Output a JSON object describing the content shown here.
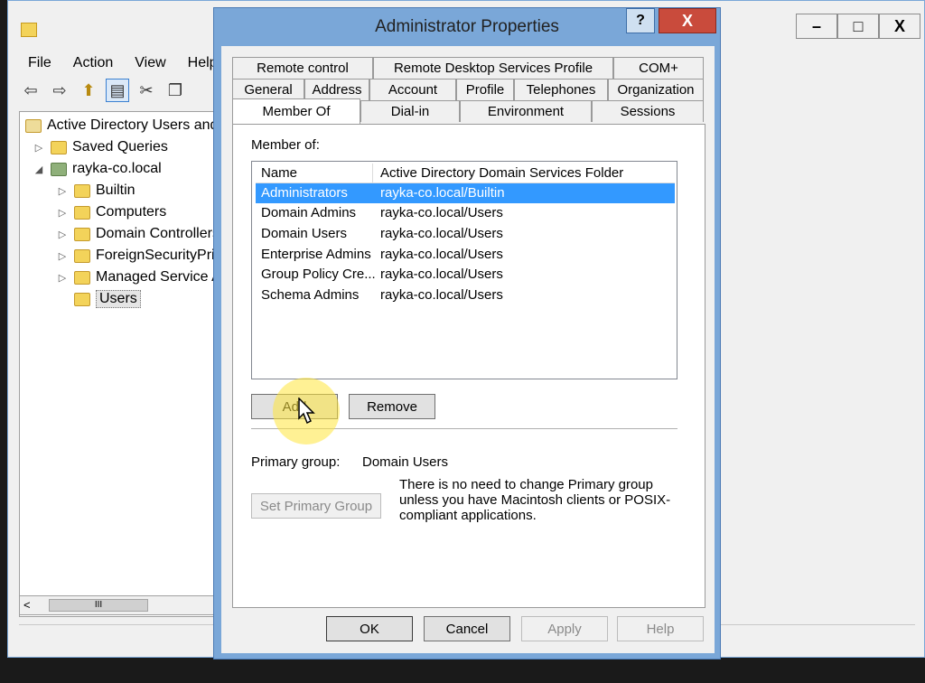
{
  "mmc": {
    "menu": [
      "File",
      "Action",
      "View",
      "Help"
    ],
    "window_buttons": [
      "–",
      "□",
      "X"
    ],
    "tree": [
      {
        "label": "Active Directory Users and",
        "level": 0,
        "expander": ""
      },
      {
        "label": "Saved Queries",
        "level": 1,
        "expander": "▷"
      },
      {
        "label": "rayka-co.local",
        "level": 1,
        "expander": "◢"
      },
      {
        "label": "Builtin",
        "level": 2,
        "expander": "▷"
      },
      {
        "label": "Computers",
        "level": 2,
        "expander": "▷"
      },
      {
        "label": "Domain Controllers",
        "level": 2,
        "expander": "▷"
      },
      {
        "label": "ForeignSecurityPrin",
        "level": 2,
        "expander": "▷"
      },
      {
        "label": "Managed Service A",
        "level": 2,
        "expander": "▷"
      },
      {
        "label": "Users",
        "level": 2,
        "expander": ""
      }
    ],
    "scroll_left": "<",
    "scroll_thumb": "III"
  },
  "dialog": {
    "title": "Administrator Properties",
    "help": "?",
    "close": "X",
    "tabs_row1": [
      "Remote control",
      "Remote Desktop Services Profile",
      "COM+"
    ],
    "tabs_row2": [
      "General",
      "Address",
      "Account",
      "Profile",
      "Telephones",
      "Organization"
    ],
    "tabs_row3": [
      "Member Of",
      "Dial-in",
      "Environment",
      "Sessions"
    ],
    "member_of_label": "Member of:",
    "columns": [
      "Name",
      "Active Directory Domain Services Folder"
    ],
    "rows": [
      {
        "name": "Administrators",
        "folder": "rayka-co.local/Builtin"
      },
      {
        "name": "Domain Admins",
        "folder": "rayka-co.local/Users"
      },
      {
        "name": "Domain Users",
        "folder": "rayka-co.local/Users"
      },
      {
        "name": "Enterprise Admins",
        "folder": "rayka-co.local/Users"
      },
      {
        "name": "Group Policy Cre...",
        "folder": "rayka-co.local/Users"
      },
      {
        "name": "Schema Admins",
        "folder": "rayka-co.local/Users"
      }
    ],
    "add": "Add",
    "remove": "Remove",
    "primary_group_label": "Primary group:",
    "primary_group_value": "Domain Users",
    "set_primary_group": "Set Primary Group",
    "note": "There is no need to change Primary group unless you have Macintosh clients or POSIX-compliant applications.",
    "ok": "OK",
    "cancel": "Cancel",
    "apply": "Apply",
    "help_button": "Help"
  }
}
